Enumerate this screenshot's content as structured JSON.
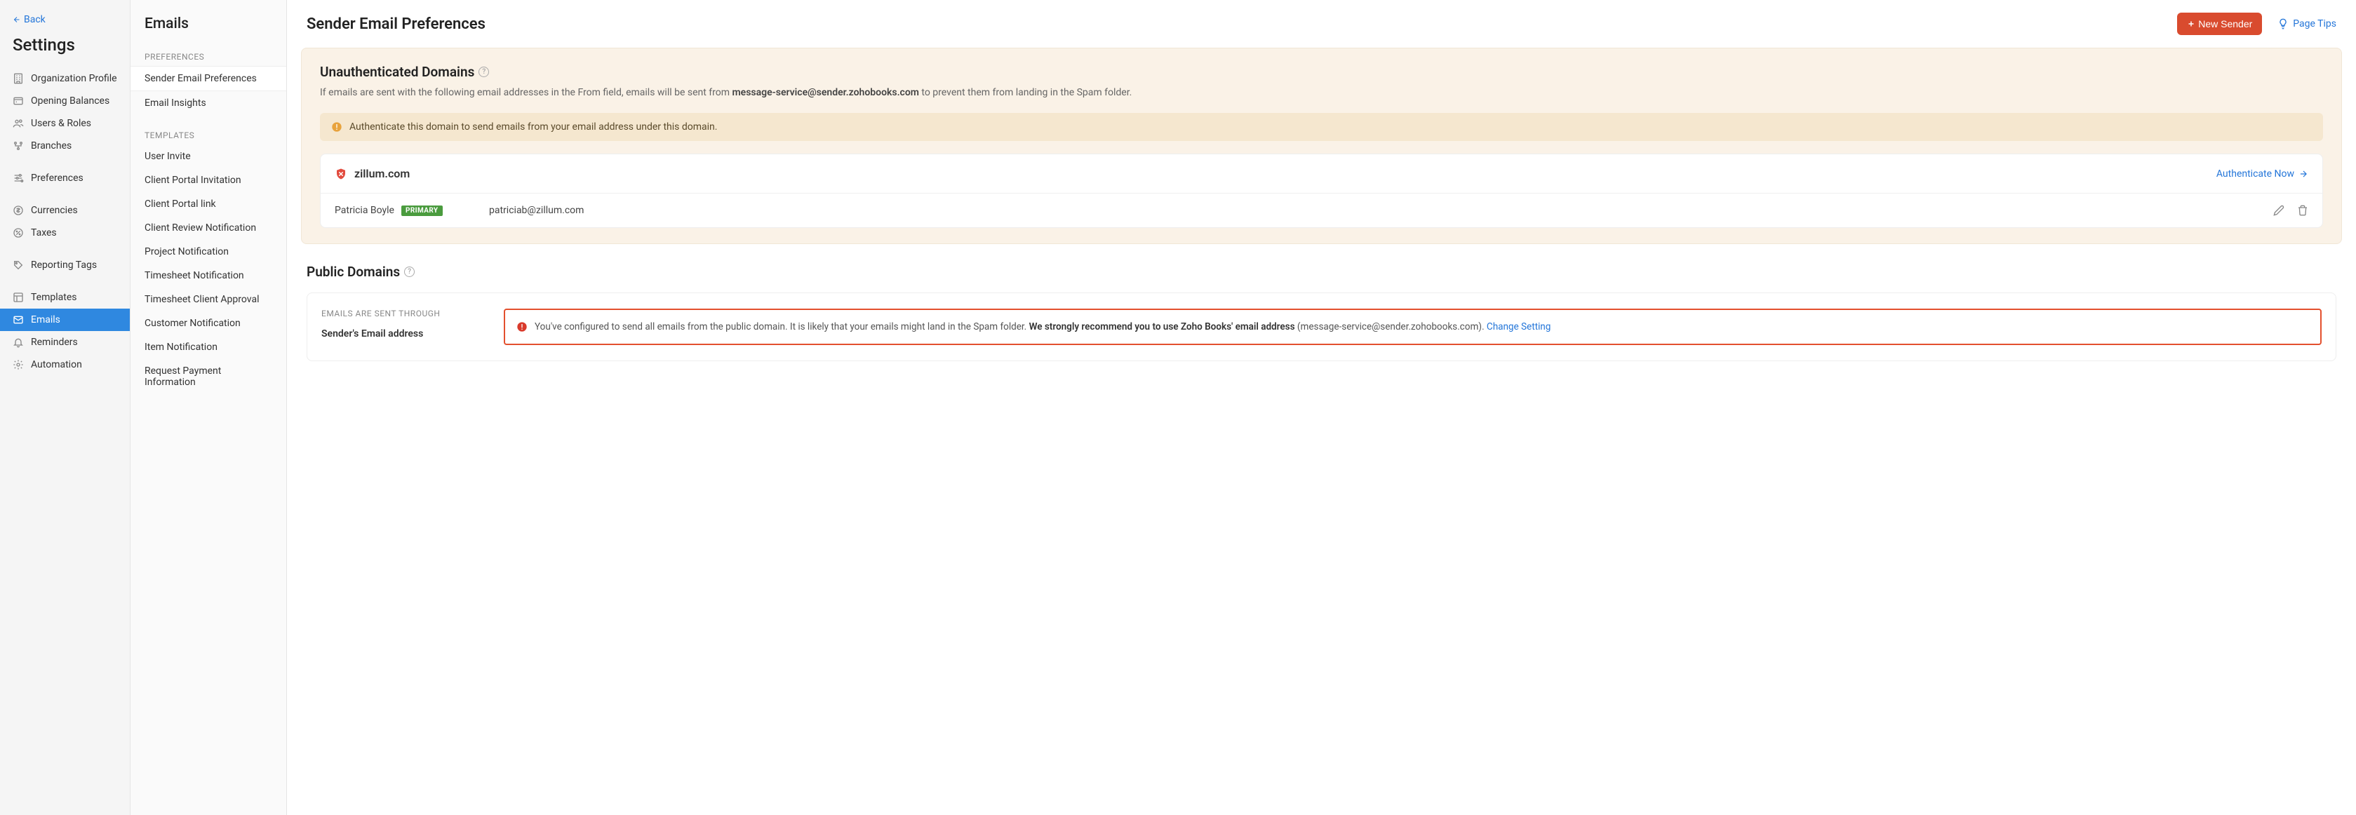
{
  "back_label": "Back",
  "settings_title": "Settings",
  "left_nav": [
    {
      "label": "Organization Profile",
      "icon": "building"
    },
    {
      "label": "Opening Balances",
      "icon": "wallet"
    },
    {
      "label": "Users & Roles",
      "icon": "users"
    },
    {
      "label": "Branches",
      "icon": "branch"
    }
  ],
  "left_nav2": [
    {
      "label": "Preferences",
      "icon": "sliders"
    }
  ],
  "left_nav3": [
    {
      "label": "Currencies",
      "icon": "dollar"
    },
    {
      "label": "Taxes",
      "icon": "percent"
    }
  ],
  "left_nav4": [
    {
      "label": "Reporting Tags",
      "icon": "tag"
    }
  ],
  "left_nav5": [
    {
      "label": "Templates",
      "icon": "layout"
    },
    {
      "label": "Emails",
      "icon": "mail",
      "active": true
    },
    {
      "label": "Reminders",
      "icon": "bell"
    },
    {
      "label": "Automation",
      "icon": "gear"
    }
  ],
  "mid_title": "Emails",
  "mid_section1": "PREFERENCES",
  "mid_items1": [
    {
      "label": "Sender Email Preferences",
      "active": true
    },
    {
      "label": "Email Insights"
    }
  ],
  "mid_section2": "TEMPLATES",
  "mid_items2": [
    {
      "label": "User Invite"
    },
    {
      "label": "Client Portal Invitation"
    },
    {
      "label": "Client Portal link"
    },
    {
      "label": "Client Review Notification"
    },
    {
      "label": "Project Notification"
    },
    {
      "label": "Timesheet Notification"
    },
    {
      "label": "Timesheet Client Approval"
    },
    {
      "label": "Customer Notification"
    },
    {
      "label": "Item Notification"
    },
    {
      "label": "Request Payment Information"
    }
  ],
  "main_title": "Sender Email Preferences",
  "new_sender_label": "New Sender",
  "page_tips_label": "Page Tips",
  "unauth": {
    "heading": "Unauthenticated Domains",
    "desc_pre": "If emails are sent with the following email addresses in the From field, emails will be sent from ",
    "desc_email": "message-service@sender.zohobooks.com",
    "desc_post": " to prevent them from landing in the Spam folder.",
    "banner": "Authenticate this domain to send emails from your email address under this domain.",
    "domain": "zillum.com",
    "auth_now": "Authenticate Now",
    "row_name": "Patricia Boyle",
    "row_badge": "PRIMARY",
    "row_email": "patriciab@zillum.com"
  },
  "public": {
    "heading": "Public Domains",
    "sent_through": "EMAILS ARE SENT THROUGH",
    "sender_label": "Sender's Email address",
    "alert_pre": "You've configured to send all emails from the public domain. It is likely that your emails might land in the Spam folder. ",
    "alert_strong": "We strongly recommend you to use Zoho Books' email address",
    "alert_paren": " (message-service@sender.zohobooks.com). ",
    "alert_link": "Change Setting"
  }
}
